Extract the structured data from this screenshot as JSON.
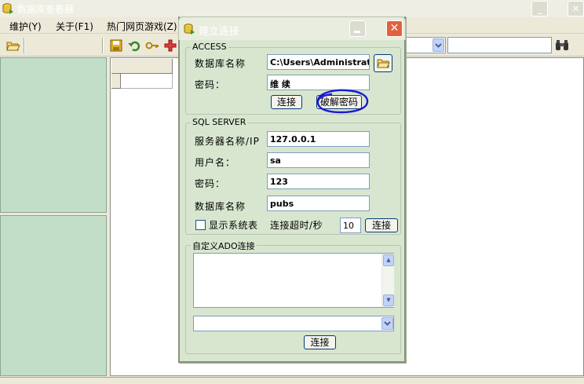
{
  "main_window": {
    "title": "数据库查看器",
    "menu": [
      "维护(Y)",
      "关于(F1)",
      "热门网页游戏(Z)"
    ]
  },
  "dialog": {
    "title": "建立连接",
    "access": {
      "legend": "ACCESS",
      "db_name_label": "数据库名称",
      "db_name_value": "C:\\Users\\Administrato",
      "password_label": "密码：",
      "password_value": "维        续",
      "connect_label": "连接",
      "crack_label": "破解密码"
    },
    "sql": {
      "legend": "SQL SERVER",
      "server_label": "服务器名称/IP",
      "server_value": "127.0.0.1",
      "user_label": "用户名：",
      "user_value": "sa",
      "password_label": "密码：",
      "password_value": "123",
      "db_label": "数据库名称",
      "db_value": "pubs",
      "show_system_label": "显示系统表",
      "show_system_checked": false,
      "timeout_label": "连接超时/秒",
      "timeout_value": "10",
      "connect_label": "连接"
    },
    "ado": {
      "legend": "自定义ADO连接",
      "connection_string": "",
      "combo_value": "",
      "connect_label": "连接"
    }
  },
  "annotation": {
    "color": "#1a1ad0"
  }
}
